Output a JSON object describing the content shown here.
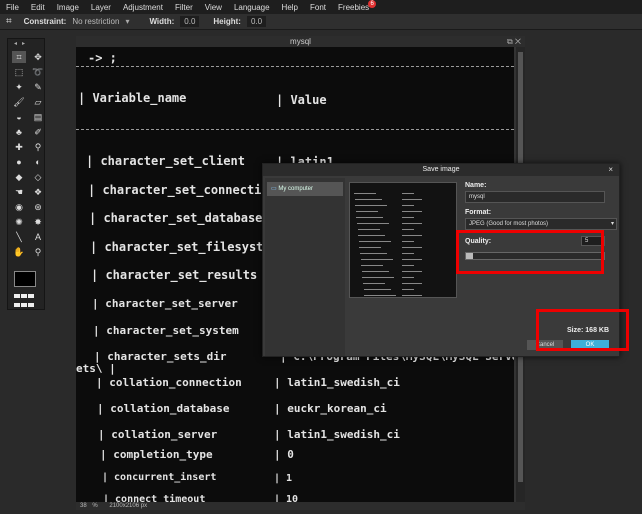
{
  "menu": [
    "File",
    "Edit",
    "Image",
    "Layer",
    "Adjustment",
    "Filter",
    "View",
    "Language",
    "Help",
    "Font",
    "Freebies"
  ],
  "freebies_badge": "6",
  "options": {
    "constraint_label": "Constraint:",
    "constraint_value": "No restriction",
    "width_label": "Width:",
    "width_value": "0.0",
    "height_label": "Height:",
    "height_value": "0.0"
  },
  "tool_icons": [
    "crop-icon",
    "move-icon",
    "marquee-icon",
    "lasso-icon",
    "wand-icon",
    "pencil-icon",
    "brush-icon",
    "eraser-icon",
    "bucket-icon",
    "gradient-icon",
    "stamp-icon",
    "color-replace-icon",
    "heal-icon",
    "eyedropper-icon",
    "dodge-icon",
    "burn-icon",
    "blur-icon",
    "sharpen-icon",
    "smudge-icon",
    "sponge-icon",
    "red-eye-icon",
    "spot-icon",
    "bloat-icon",
    "pinch-icon",
    "line-icon",
    "text-icon",
    "hand-icon",
    "zoom-icon"
  ],
  "document": {
    "title": "mysql",
    "zoom": "38",
    "zoom_unit": "%",
    "dimensions": "2100x2106 px"
  },
  "terminal_lines": [
    "-> ;",
    "| Variable_name",
    "| Value",
    "| character_set_client",
    "| latin1",
    "| character_set_connection",
    "| character_set_database",
    "| character_set_filesystem",
    "| character_set_results",
    "| character_set_server",
    "| character_set_system",
    "| character_sets_dir",
    "| C:\\Program Files\\MySQL\\MySQL Server",
    "ets\\ |",
    "| collation_connection",
    "| latin1_swedish_ci",
    "| collation_database",
    "| euckr_korean_ci",
    "| collation_server",
    "| latin1_swedish_ci",
    "| completion_type",
    "| 0",
    "| concurrent_insert",
    "| 1",
    "| connect_timeout",
    "| 10"
  ],
  "dialog": {
    "title": "Save image",
    "close": "×",
    "sidebar_item": "My computer",
    "name_label": "Name:",
    "name_value": "mysql",
    "format_label": "Format:",
    "format_value": "JPEG (Good for most photos)",
    "quality_label": "Quality:",
    "quality_value": "5",
    "quality_fraction": 0.05,
    "size_text": "Size: 168 KB",
    "cancel_label": "Cancel",
    "ok_label": "OK"
  },
  "colors": {
    "highlight_red": "#e00000",
    "ok_blue": "#3fb0d8"
  }
}
